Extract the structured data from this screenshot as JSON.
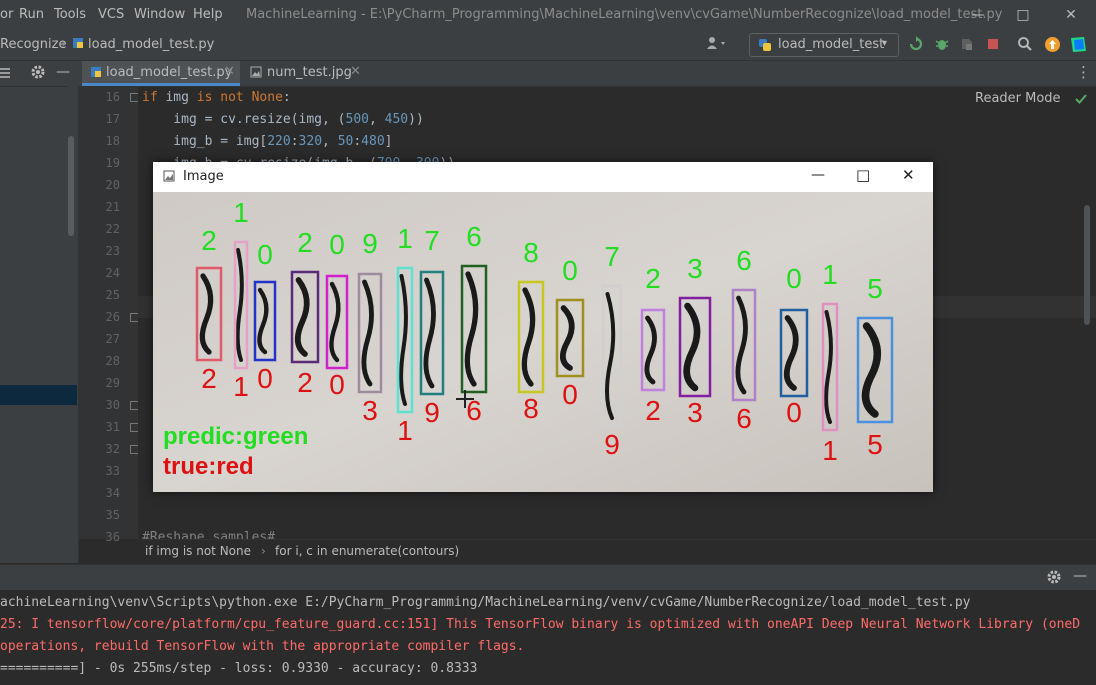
{
  "menu": {
    "items": [
      "or",
      "Run",
      "Tools",
      "VCS",
      "Window",
      "Help"
    ],
    "title": "MachineLearning - E:\\PyCharm_Programming\\MachineLearning\\venv\\cvGame\\NumberRecognize\\load_model_test.py"
  },
  "nav": {
    "crumb_project": "Recognize",
    "crumb_file": "load_model_test.py",
    "run_config": "load_model_test"
  },
  "tabs": [
    {
      "label": "load_model_test.py",
      "active": true
    },
    {
      "label": "num_test.jpg",
      "active": false
    }
  ],
  "editor": {
    "reader_mode": "Reader Mode",
    "lines": [
      {
        "n": "16",
        "text": "if img is not None:"
      },
      {
        "n": "17",
        "text": "    img = cv.resize(img, (500, 450))"
      },
      {
        "n": "18",
        "text": "    img_b = img[220:320, 50:480]"
      },
      {
        "n": "19",
        "text": "    img_b = cv.resize(img_b, (700, 300))"
      },
      {
        "n": "20",
        "text": ""
      },
      {
        "n": "21",
        "text": ""
      },
      {
        "n": "22",
        "text": ""
      },
      {
        "n": "23",
        "text": ""
      },
      {
        "n": "24",
        "text": ""
      },
      {
        "n": "25",
        "text": ""
      },
      {
        "n": "26",
        "text": ""
      },
      {
        "n": "27",
        "text": ""
      },
      {
        "n": "28",
        "text": ""
      },
      {
        "n": "29",
        "text": ""
      },
      {
        "n": "30",
        "text": ""
      },
      {
        "n": "31",
        "text": ""
      },
      {
        "n": "32",
        "text": ""
      },
      {
        "n": "33",
        "text": ""
      },
      {
        "n": "34",
        "text": ""
      },
      {
        "n": "35",
        "text": ""
      },
      {
        "n": "36",
        "text": "#Reshape samples#"
      }
    ],
    "breadcrumb_1": "if img is not None",
    "breadcrumb_2": "for i, c in enumerate(contours)"
  },
  "image_window": {
    "title": "Image",
    "legend_pred": "predic:green",
    "legend_true": "true:red",
    "digits": [
      {
        "pred": "2",
        "truth": "2",
        "box": "#e05a6a"
      },
      {
        "pred": "1",
        "truth": "1",
        "box": "#e8a0c8"
      },
      {
        "pred": "0",
        "truth": "0",
        "box": "#2233cc"
      },
      {
        "pred": "2",
        "truth": "2",
        "box": "#5a2a7a"
      },
      {
        "pred": "0",
        "truth": "0",
        "box": "#d020d0"
      },
      {
        "pred": "9",
        "truth": "3",
        "box": "#a08aa0"
      },
      {
        "pred": "1",
        "truth": "1",
        "box": "#60e0d0"
      },
      {
        "pred": "7",
        "truth": "9",
        "box": "#208080"
      },
      {
        "pred": "6",
        "truth": "6",
        "box": "#206020"
      },
      {
        "pred": "8",
        "truth": "8",
        "box": "#c8c820"
      },
      {
        "pred": "0",
        "truth": "0",
        "box": "#a09020"
      },
      {
        "pred": "7",
        "truth": "9",
        "box": "#d0d0d0"
      },
      {
        "pred": "2",
        "truth": "2",
        "box": "#c080e0"
      },
      {
        "pred": "3",
        "truth": "3",
        "box": "#8020a0"
      },
      {
        "pred": "6",
        "truth": "6",
        "box": "#b080c8"
      },
      {
        "pred": "0",
        "truth": "0",
        "box": "#2060a0"
      },
      {
        "pred": "1",
        "truth": "1",
        "box": "#e090c0"
      },
      {
        "pred": "5",
        "truth": "5",
        "box": "#4a90e0"
      }
    ]
  },
  "console": {
    "line1": "achineLearning\\venv\\Scripts\\python.exe E:/PyCharm_Programming/MachineLearning/venv/cvGame/NumberRecognize/load_model_test.py",
    "line2": "25: I tensorflow/core/platform/cpu_feature_guard.cc:151] This TensorFlow binary is optimized with oneAPI Deep Neural Network Library (oneD",
    "line3": "operations, rebuild TensorFlow with the appropriate compiler flags.",
    "line4": "==========] - 0s 255ms/step - loss: 0.9330 - accuracy: 0.8333"
  },
  "colors": {
    "pred": "#22dd22",
    "truth": "#dd1111",
    "accent": "#4a88c7"
  }
}
